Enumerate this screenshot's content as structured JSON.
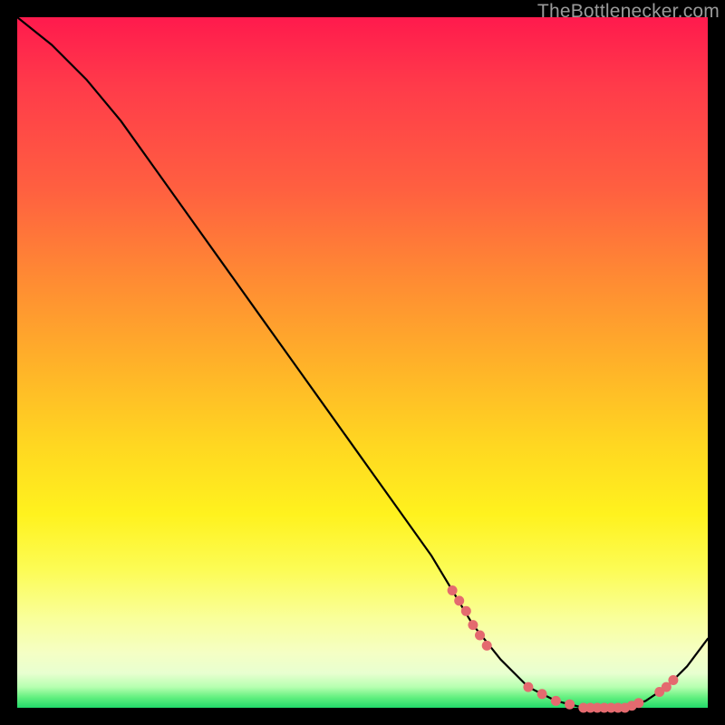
{
  "attribution": "TheBottlenecker.com",
  "chart_data": {
    "type": "line",
    "title": "",
    "xlabel": "",
    "ylabel": "",
    "xlim": [
      0,
      100
    ],
    "ylim": [
      0,
      100
    ],
    "series": [
      {
        "name": "bottleneck-curve",
        "x": [
          0,
          5,
          10,
          15,
          20,
          25,
          30,
          35,
          40,
          45,
          50,
          55,
          60,
          63,
          66,
          70,
          74,
          78,
          82,
          85,
          88,
          91,
          94,
          97,
          100
        ],
        "y": [
          100,
          96,
          91,
          85,
          78,
          71,
          64,
          57,
          50,
          43,
          36,
          29,
          22,
          17,
          12,
          7,
          3,
          1,
          0,
          0,
          0,
          1,
          3,
          6,
          10
        ]
      }
    ],
    "markers": {
      "name": "highlight-dots",
      "color": "#e46a6f",
      "x": [
        63,
        64,
        65,
        66,
        67,
        68,
        74,
        76,
        78,
        80,
        82,
        83,
        84,
        85,
        86,
        87,
        88,
        89,
        90,
        93,
        94,
        95
      ],
      "y": [
        17,
        15.5,
        14,
        12,
        10.5,
        9,
        3,
        2,
        1,
        0.5,
        0,
        0,
        0,
        0,
        0,
        0,
        0,
        0.3,
        0.7,
        2.3,
        3,
        4
      ]
    },
    "background_gradient": {
      "top": "#ff1a4d",
      "mid": "#ffe21e",
      "bottom": "#22d96a"
    }
  }
}
